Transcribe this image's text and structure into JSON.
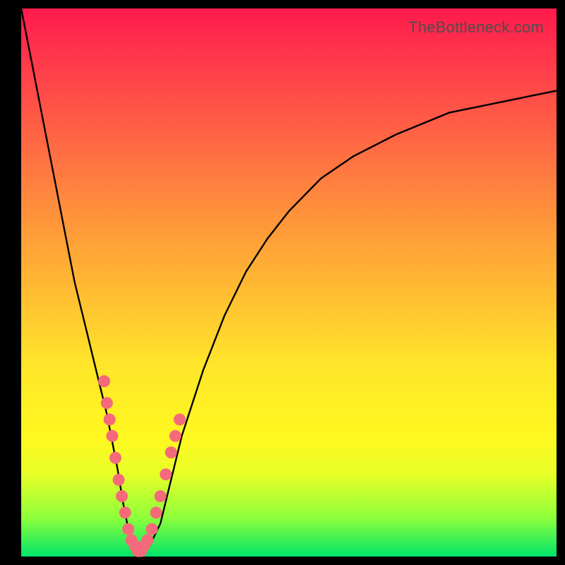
{
  "watermark": "TheBottleneck.com",
  "chart_data": {
    "type": "line",
    "title": "",
    "xlabel": "",
    "ylabel": "",
    "xlim": [
      0,
      100
    ],
    "ylim": [
      0,
      100
    ],
    "series": [
      {
        "name": "bottleneck-curve",
        "x": [
          0,
          2,
          4,
          6,
          8,
          10,
          12,
          14,
          16,
          18,
          19,
          20,
          21,
          22,
          23,
          24,
          26,
          28,
          30,
          34,
          38,
          42,
          46,
          50,
          56,
          62,
          70,
          80,
          90,
          100
        ],
        "y": [
          100,
          90,
          80,
          70,
          60,
          50,
          42,
          34,
          26,
          16,
          10,
          5,
          2,
          1,
          1,
          2,
          6,
          14,
          22,
          34,
          44,
          52,
          58,
          63,
          69,
          73,
          77,
          81,
          83,
          85
        ]
      }
    ],
    "markers": {
      "name": "highlight-dots",
      "color": "#f56a7a",
      "points": [
        {
          "x": 15.5,
          "y": 32
        },
        {
          "x": 16.0,
          "y": 28
        },
        {
          "x": 16.5,
          "y": 25
        },
        {
          "x": 17.0,
          "y": 22
        },
        {
          "x": 17.6,
          "y": 18
        },
        {
          "x": 18.2,
          "y": 14
        },
        {
          "x": 18.8,
          "y": 11
        },
        {
          "x": 19.4,
          "y": 8
        },
        {
          "x": 20.0,
          "y": 5
        },
        {
          "x": 20.6,
          "y": 3
        },
        {
          "x": 21.2,
          "y": 2
        },
        {
          "x": 21.8,
          "y": 1
        },
        {
          "x": 22.4,
          "y": 1
        },
        {
          "x": 23.0,
          "y": 2
        },
        {
          "x": 23.6,
          "y": 3
        },
        {
          "x": 24.4,
          "y": 5
        },
        {
          "x": 25.2,
          "y": 8
        },
        {
          "x": 26.0,
          "y": 11
        },
        {
          "x": 27.0,
          "y": 15
        },
        {
          "x": 28.0,
          "y": 19
        },
        {
          "x": 28.8,
          "y": 22
        },
        {
          "x": 29.6,
          "y": 25
        }
      ]
    },
    "gradient_stops": [
      {
        "pos": 0,
        "color": "#ff1a4d"
      },
      {
        "pos": 25,
        "color": "#ff6a44"
      },
      {
        "pos": 50,
        "color": "#ffb733"
      },
      {
        "pos": 78,
        "color": "#fff820"
      },
      {
        "pos": 100,
        "color": "#00e46a"
      }
    ]
  }
}
